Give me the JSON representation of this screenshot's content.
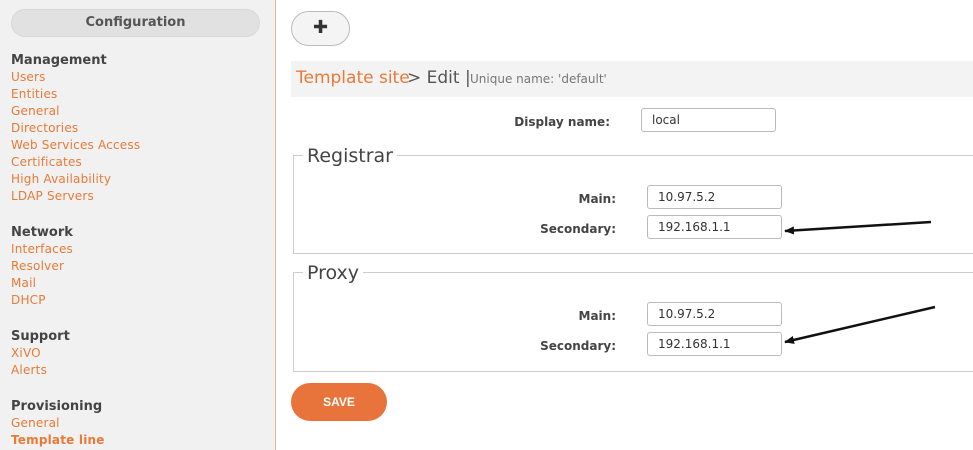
{
  "sidebar": {
    "config_label": "Configuration",
    "sections": [
      {
        "title": "Management",
        "items": [
          "Users",
          "Entities",
          "General",
          "Directories",
          "Web Services Access",
          "Certificates",
          "High Availability",
          "LDAP Servers"
        ]
      },
      {
        "title": "Network",
        "items": [
          "Interfaces",
          "Resolver",
          "Mail",
          "DHCP"
        ]
      },
      {
        "title": "Support",
        "items": [
          "XiVO",
          "Alerts"
        ]
      },
      {
        "title": "Provisioning",
        "items": [
          "General",
          "Template line"
        ]
      }
    ],
    "active_item": "Template line"
  },
  "toolbar": {
    "add_glyph": "✚"
  },
  "header": {
    "breadcrumb_link": "Template site",
    "separator_edit": "> Edit |",
    "unique_name": "Unique name: 'default'"
  },
  "form": {
    "display_name_label": "Display name:",
    "display_name_value": "local",
    "registrar": {
      "legend": "Registrar",
      "main_label": "Main:",
      "main_value": "10.97.5.2",
      "secondary_label": "Secondary:",
      "secondary_value": "192.168.1.1"
    },
    "proxy": {
      "legend": "Proxy",
      "main_label": "Main:",
      "main_value": "10.97.5.2",
      "secondary_label": "Secondary:",
      "secondary_value": "192.168.1.1"
    },
    "save_label": "SAVE"
  },
  "colors": {
    "accent": "#e8743b",
    "link": "#e87a38"
  }
}
